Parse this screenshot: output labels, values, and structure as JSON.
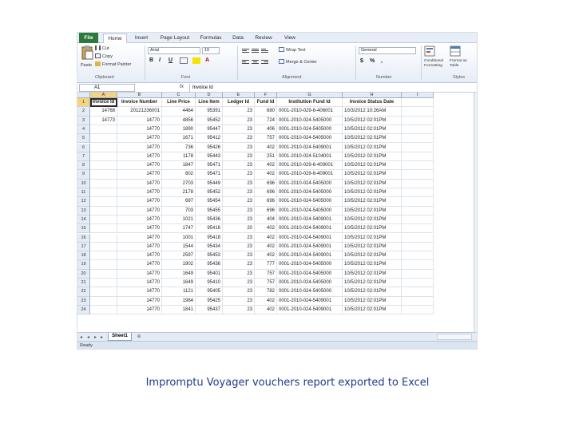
{
  "tabs": [
    "File",
    "Home",
    "Insert",
    "Page Layout",
    "Formulas",
    "Data",
    "Review",
    "View"
  ],
  "active_tab": "Home",
  "ribbon": {
    "clipboard": {
      "paste": "Paste",
      "cut": "Cut",
      "copy": "Copy",
      "format_painter": "Format Painter",
      "label": "Clipboard"
    },
    "font": {
      "name": "Arial",
      "size": "10",
      "bold": "B",
      "italic": "I",
      "underline": "U",
      "grow": "A",
      "label": "Font"
    },
    "alignment": {
      "wrap": "Wrap Text",
      "merge": "Merge & Center",
      "label": "Alignment"
    },
    "number": {
      "format": "General",
      "currency": "$",
      "percent": "%",
      "comma": ",",
      "label": "Number"
    },
    "styles": {
      "conditional": "Conditional Formatting",
      "format_table": "Format as Table",
      "label": "Styles"
    }
  },
  "formula_bar": {
    "name_box": "A1",
    "fx": "fx",
    "value": "Invoice Id"
  },
  "columns": [
    "A",
    "B",
    "C",
    "D",
    "E",
    "F",
    "G",
    "H",
    "I"
  ],
  "table": {
    "headers": [
      "Invoice Id",
      "Invoice Number",
      "Line Price",
      "Line Item",
      "Ledger Id",
      "Fund Id",
      "Institution Fund Id",
      "Invoice Status Date"
    ],
    "rows": [
      [
        "14768",
        "20121236001",
        "4464",
        "95391",
        "23",
        "680",
        "0001-2010-029-6-406001",
        "10/3/2012 10:26AM"
      ],
      [
        "14773",
        "14770",
        "4856",
        "95452",
        "23",
        "724",
        "0001-2010-024-5405000",
        "10/5/2012 02:01PM"
      ],
      [
        "",
        "14770",
        "1890",
        "95447",
        "23",
        "406",
        "0001-2010-024-5405000",
        "10/5/2012 02:01PM"
      ],
      [
        "",
        "14770",
        "1671",
        "95412",
        "23",
        "757",
        "0001-2010-024-5405000",
        "10/5/2012 02:01PM"
      ],
      [
        "",
        "14770",
        "736",
        "95426",
        "23",
        "402",
        "0001-2010-024-5409001",
        "10/5/2012 02:01PM"
      ],
      [
        "",
        "14770",
        "1178",
        "95443",
        "23",
        "251",
        "0001-2010-024-5104001",
        "10/5/2012 02:01PM"
      ],
      [
        "",
        "14770",
        "1847",
        "95471",
        "23",
        "402",
        "0001-2010-029-6-409001",
        "10/5/2012 02:01PM"
      ],
      [
        "",
        "14770",
        "802",
        "95471",
        "23",
        "402",
        "0001-2010-029-6-409001",
        "10/5/2012 02:01PM"
      ],
      [
        "",
        "14770",
        "2703",
        "95449",
        "23",
        "696",
        "0001-2010-024-5405000",
        "10/5/2012 02:01PM"
      ],
      [
        "",
        "14770",
        "2178",
        "95452",
        "23",
        "696",
        "0001-2010-024-5405000",
        "10/5/2012 02:01PM"
      ],
      [
        "",
        "14770",
        "697",
        "95454",
        "23",
        "696",
        "0001-2010-024-5405000",
        "10/5/2012 02:01PM"
      ],
      [
        "",
        "14770",
        "703",
        "95455",
        "23",
        "696",
        "0001-2010-024-5405000",
        "10/5/2012 02:01PM"
      ],
      [
        "",
        "14770",
        "1021",
        "95436",
        "23",
        "404",
        "0001-2010-024-5409001",
        "10/5/2012 02:01PM"
      ],
      [
        "",
        "14770",
        "1747",
        "95416",
        "20",
        "402",
        "0001-2010-024-5409001",
        "10/5/2012 02:01PM"
      ],
      [
        "",
        "14770",
        "1001",
        "95418",
        "23",
        "402",
        "0001-2010-024-5409001",
        "10/5/2012 02:01PM"
      ],
      [
        "",
        "14770",
        "1544",
        "95434",
        "23",
        "402",
        "0001-2010-024-5409001",
        "10/5/2012 02:01PM"
      ],
      [
        "",
        "14770",
        "2597",
        "95453",
        "23",
        "402",
        "0001-2010-024-5409001",
        "10/5/2012 02:01PM"
      ],
      [
        "",
        "14770",
        "1902",
        "95436",
        "23",
        "777",
        "0001-2010-024-5405000",
        "10/5/2012 02:01PM"
      ],
      [
        "",
        "14770",
        "1649",
        "95401",
        "23",
        "757",
        "0001-2010-024-5405000",
        "10/5/2012 02:01PM"
      ],
      [
        "",
        "14770",
        "1649",
        "95410",
        "23",
        "757",
        "0001-2010-024-5405000",
        "10/5/2012 02:01PM"
      ],
      [
        "",
        "14770",
        "1121",
        "95405",
        "23",
        "782",
        "0001-2010-024-5405000",
        "10/5/2012 02:01PM"
      ],
      [
        "",
        "14770",
        "1984",
        "95425",
        "23",
        "402",
        "0001-2010-024-5409001",
        "10/5/2012 02:01PM"
      ],
      [
        "",
        "14770",
        "1841",
        "95437",
        "23",
        "402",
        "0001-2010-024-5409001",
        "10/5/2012 02:01PM"
      ]
    ]
  },
  "sheet_tab": "Sheet1",
  "status": "Ready",
  "caption": "Impromptu Voyager vouchers report exported to Excel",
  "colors": {
    "file_tab": "#2a7a3b",
    "selected_header": "#f7d37e",
    "caption": "#1f3b8c"
  }
}
